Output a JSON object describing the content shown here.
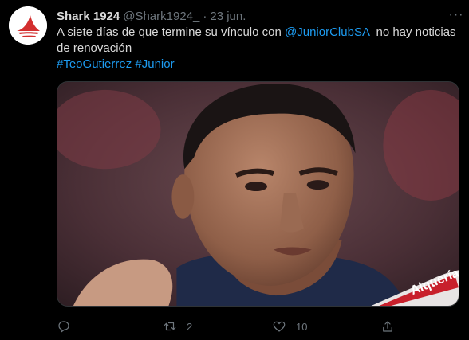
{
  "tweet": {
    "display_name": "Shark 1924",
    "handle": "@Shark1924_",
    "separator": "·",
    "date": "23 jun.",
    "more_label": "···",
    "text_line1_before": "A siete días de que termine su vínculo con ",
    "mention": "@JuniorClubSA",
    "text_line1_after": "  no hay noticias",
    "text_line2": "de renovación",
    "hashtags": [
      "#TeoGutierrez",
      "#Junior"
    ],
    "media_overlay_text": "Alquería",
    "media_alt_description": "",
    "retweet_count": "2",
    "like_count": "10"
  },
  "icons": {
    "avatar": "shark-logo-icon",
    "reply": "reply-icon",
    "retweet": "retweet-icon",
    "like": "heart-icon",
    "share": "share-icon"
  },
  "colors": {
    "background": "#000000",
    "text": "#d9d9d9",
    "muted": "#6e767d",
    "link": "#1d9bf0",
    "logo_red": "#d32f2f"
  }
}
